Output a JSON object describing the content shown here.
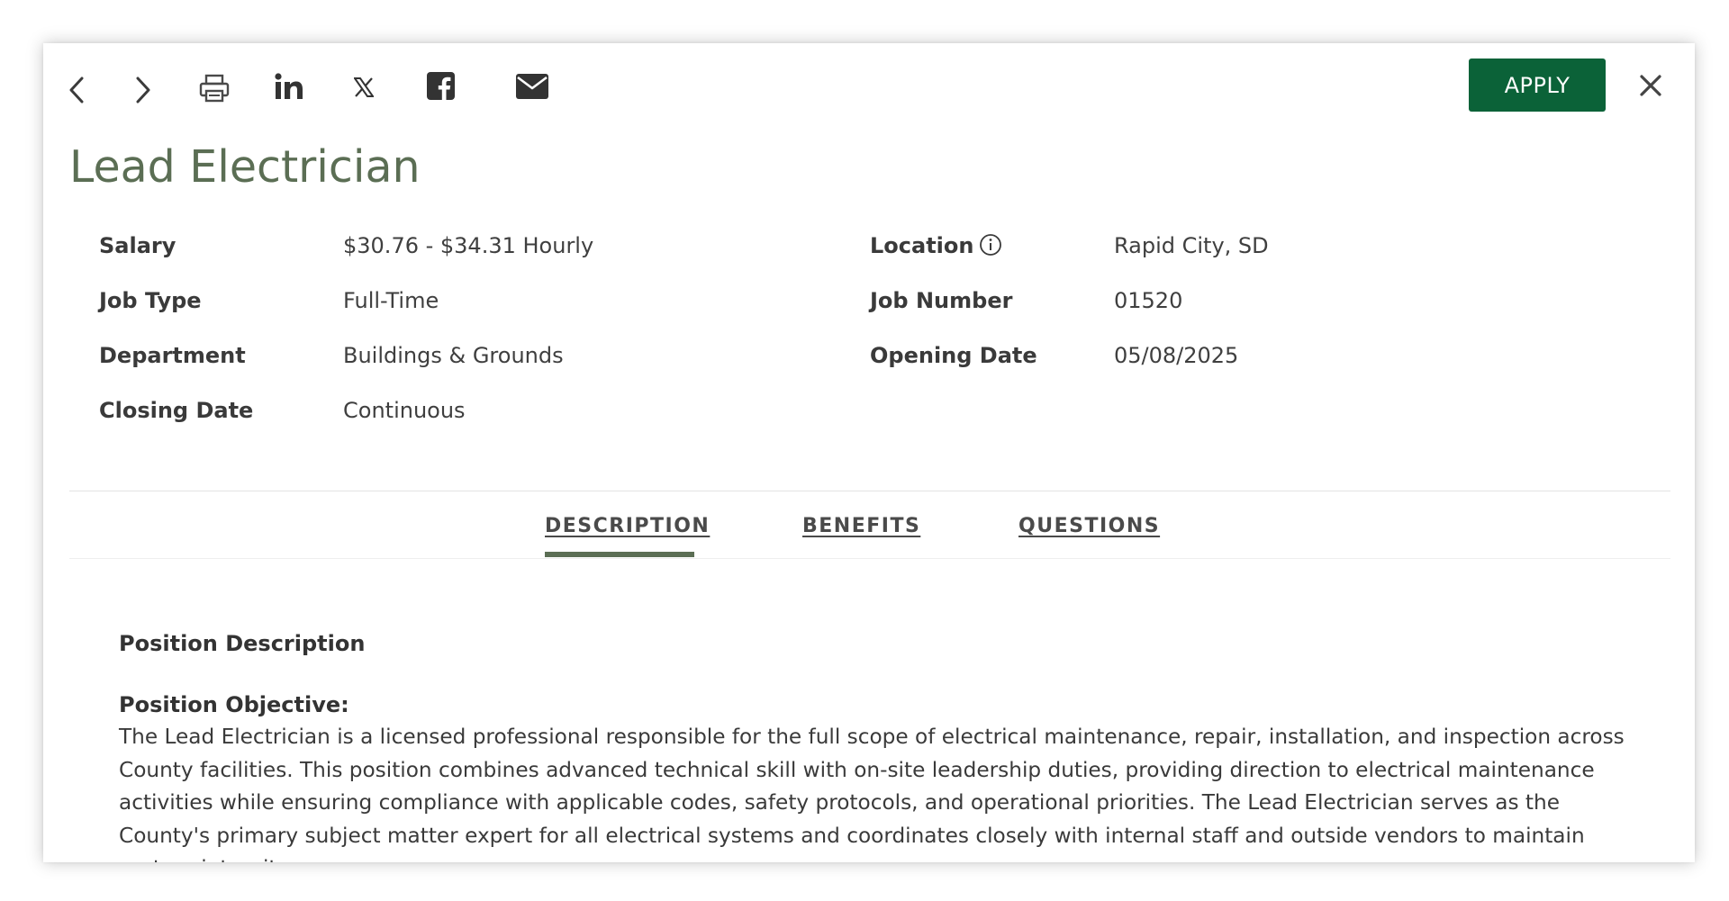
{
  "toolbar": {
    "icons": [
      "chevron-left-icon",
      "chevron-right-icon",
      "print-icon",
      "linkedin-icon",
      "x-twitter-icon",
      "facebook-icon",
      "mail-icon",
      "close-icon"
    ],
    "apply_label": "APPLY"
  },
  "job": {
    "title": "Lead Electrician",
    "details_left": [
      {
        "label": "Salary",
        "value": "$30.76 - $34.31 Hourly"
      },
      {
        "label": "Job Type",
        "value": "Full-Time"
      },
      {
        "label": "Department",
        "value": "Buildings & Grounds"
      },
      {
        "label": "Closing Date",
        "value": "Continuous"
      }
    ],
    "details_right": [
      {
        "label": "Location",
        "value": "Rapid City, SD"
      },
      {
        "label": "Job Number",
        "value": "01520"
      },
      {
        "label": "Opening Date",
        "value": "05/08/2025"
      }
    ]
  },
  "tabs": [
    {
      "label": "DESCRIPTION",
      "active": true
    },
    {
      "label": "BENEFITS",
      "active": false
    },
    {
      "label": "QUESTIONS",
      "active": false
    }
  ],
  "content": {
    "section_heading": "Position Description",
    "objective_heading": "Position Objective:",
    "objective_body": "The Lead Electrician is a licensed professional responsible for the full scope of electrical maintenance, repair, installation, and inspection across County facilities. This position combines advanced technical skill with on-site leadership duties, providing direction to electrical maintenance activities while ensuring compliance with applicable codes, safety protocols, and operational priorities. The Lead Electrician serves as the County's primary subject matter expert for all electrical systems and coordinates closely with internal staff and outside vendors to maintain system integrity."
  },
  "colors": {
    "accent": "#5b6e54",
    "apply_button": "#0b6238",
    "text": "#3a3a3a"
  }
}
